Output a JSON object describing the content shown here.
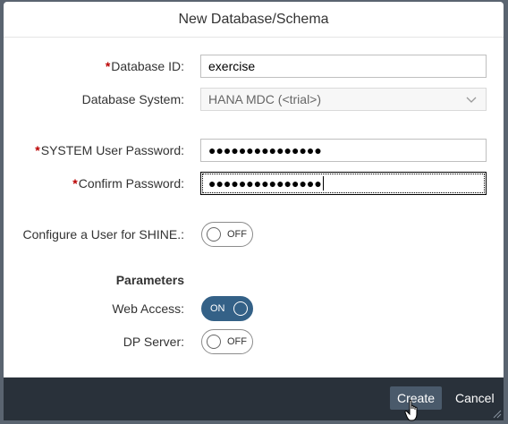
{
  "dialog": {
    "title": "New Database/Schema"
  },
  "form": {
    "database_id": {
      "label": "Database ID:",
      "required_mark": "*",
      "value": "exercise"
    },
    "database_system": {
      "label": "Database System:",
      "value": "HANA MDC (<trial>)"
    },
    "system_password": {
      "label": "SYSTEM User Password:",
      "required_mark": "*",
      "value": "●●●●●●●●●●●●●●●"
    },
    "confirm_password": {
      "label": "Confirm Password:",
      "required_mark": "*",
      "value": "●●●●●●●●●●●●●●●"
    },
    "shine_user": {
      "label": "Configure a User for SHINE.:",
      "state": "OFF"
    }
  },
  "parameters": {
    "title": "Parameters",
    "web_access": {
      "label": "Web Access:",
      "state": "ON"
    },
    "dp_server": {
      "label": "DP Server:",
      "state": "OFF"
    }
  },
  "footer": {
    "create_label": "Create",
    "cancel_label": "Cancel"
  },
  "colors": {
    "footer_bg": "#29313a",
    "toggle_on": "#346187",
    "required": "#bb0000"
  }
}
